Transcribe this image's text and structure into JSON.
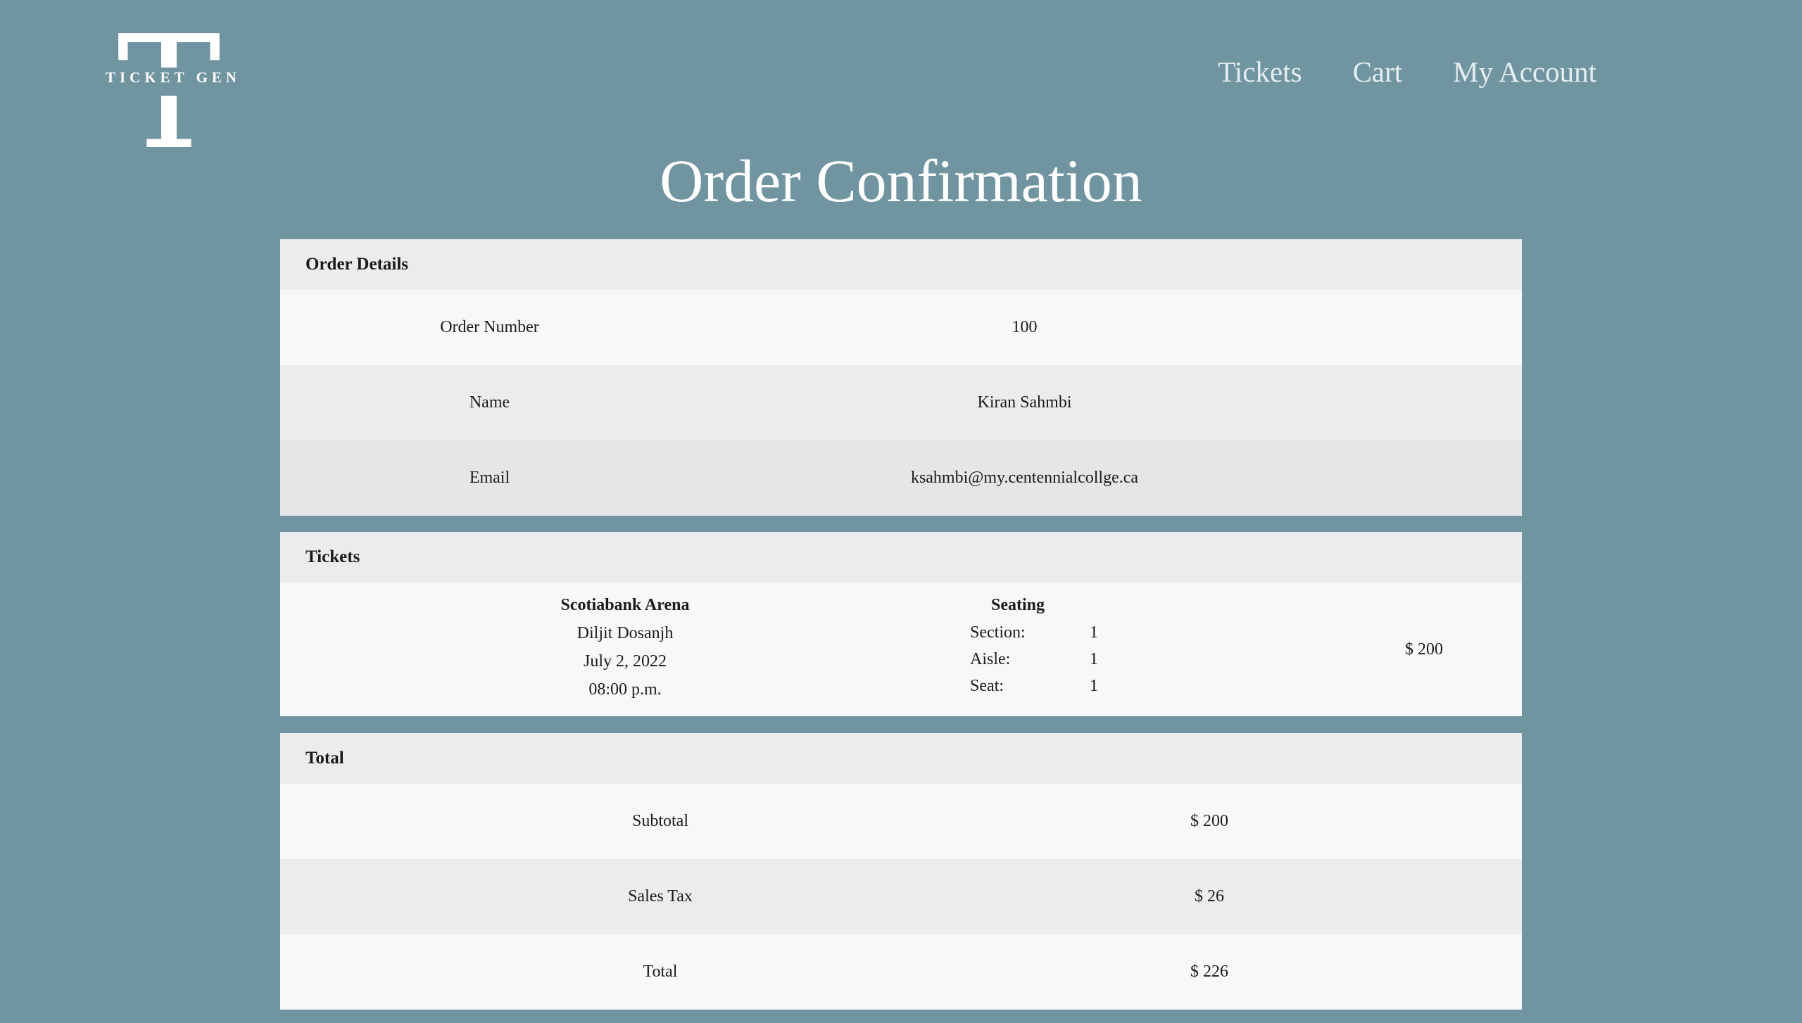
{
  "logo": {
    "letter": "T",
    "text": "TICKET GEN"
  },
  "nav": {
    "tickets": "Tickets",
    "cart": "Cart",
    "account": "My Account"
  },
  "page_title": "Order Confirmation",
  "order_details": {
    "header": "Order Details",
    "rows": [
      {
        "label": "Order Number",
        "value": "100"
      },
      {
        "label": "Name",
        "value": "Kiran Sahmbi"
      },
      {
        "label": "Email",
        "value": "ksahmbi@my.centennialcollge.ca"
      }
    ]
  },
  "tickets": {
    "header": "Tickets",
    "venue": "Scotiabank Arena",
    "artist": "Diljit Dosanjh",
    "date": "July 2, 2022",
    "time": "08:00 p.m.",
    "seating_title": "Seating",
    "seating": [
      {
        "label": "Section:",
        "value": "1"
      },
      {
        "label": "Aisle:",
        "value": "1"
      },
      {
        "label": "Seat:",
        "value": "1"
      }
    ],
    "price": "$ 200"
  },
  "total": {
    "header": "Total",
    "rows": [
      {
        "label": "Subtotal",
        "value": "$ 200"
      },
      {
        "label": "Sales Tax",
        "value": "$ 26"
      },
      {
        "label": "Total",
        "value": "$ 226"
      }
    ]
  },
  "colors": {
    "background": "#7095a1",
    "header_row": "#ececee",
    "light_row": "#f7f8fa"
  }
}
